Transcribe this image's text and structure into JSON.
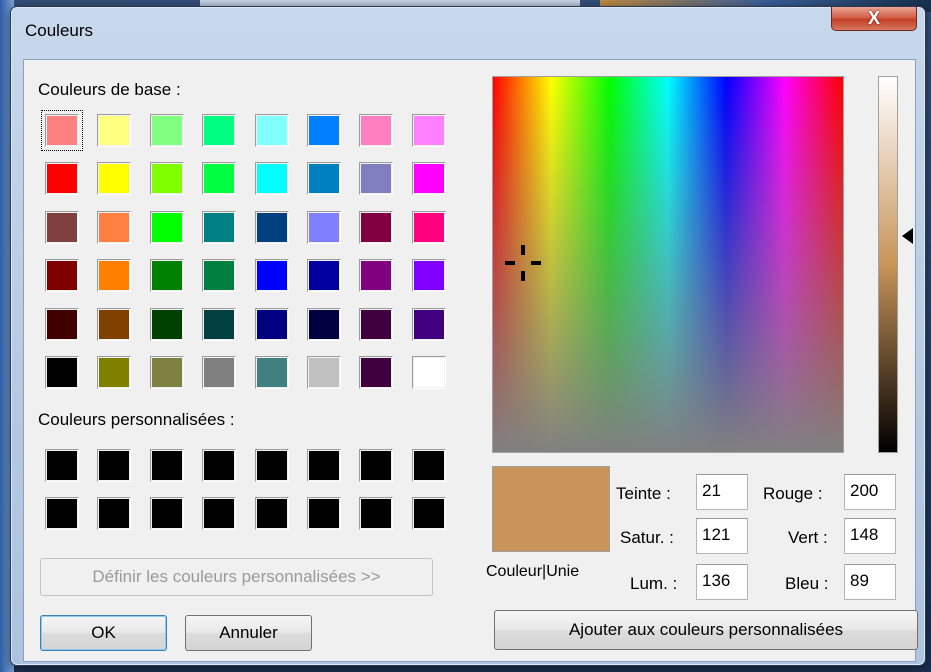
{
  "window": {
    "title": "Couleurs",
    "close_label": "X"
  },
  "basic_colors": {
    "label": "Couleurs de base :",
    "rows": [
      [
        "#ff8080",
        "#ffff80",
        "#80ff80",
        "#00ff80",
        "#80ffff",
        "#0080ff",
        "#ff80c0",
        "#ff80ff"
      ],
      [
        "#ff0000",
        "#ffff00",
        "#80ff00",
        "#00ff40",
        "#00ffff",
        "#0080c0",
        "#8080c0",
        "#ff00ff"
      ],
      [
        "#804040",
        "#ff8040",
        "#00ff00",
        "#008080",
        "#004080",
        "#8080ff",
        "#800040",
        "#ff0080"
      ],
      [
        "#800000",
        "#ff8000",
        "#008000",
        "#008040",
        "#0000ff",
        "#0000a0",
        "#800080",
        "#8000ff"
      ],
      [
        "#400000",
        "#804000",
        "#004000",
        "#004040",
        "#000080",
        "#000040",
        "#400040",
        "#400080"
      ],
      [
        "#000000",
        "#808000",
        "#808040",
        "#808080",
        "#408080",
        "#c0c0c0",
        "#400040",
        "#ffffff"
      ]
    ]
  },
  "custom_colors": {
    "label": "Couleurs personnalisées :",
    "rows": [
      [
        "#000000",
        "#000000",
        "#000000",
        "#000000",
        "#000000",
        "#000000",
        "#000000",
        "#000000"
      ],
      [
        "#000000",
        "#000000",
        "#000000",
        "#000000",
        "#000000",
        "#000000",
        "#000000",
        "#000000"
      ]
    ]
  },
  "buttons": {
    "define_custom": "Définir les couleurs personnalisées >>",
    "ok": "OK",
    "cancel": "Annuler",
    "add_custom": "Ajouter aux couleurs personnalisées"
  },
  "preview": {
    "label": "Couleur|Unie",
    "color": "#c89459"
  },
  "fields": {
    "hue_label": "Teinte :",
    "hue": "21",
    "sat_label": "Satur. :",
    "sat": "121",
    "lum_label": "Lum. :",
    "lum": "136",
    "red_label": "Rouge :",
    "red": "200",
    "green_label": "Vert :",
    "green": "148",
    "blue_label": "Bleu :",
    "blue": "89"
  }
}
